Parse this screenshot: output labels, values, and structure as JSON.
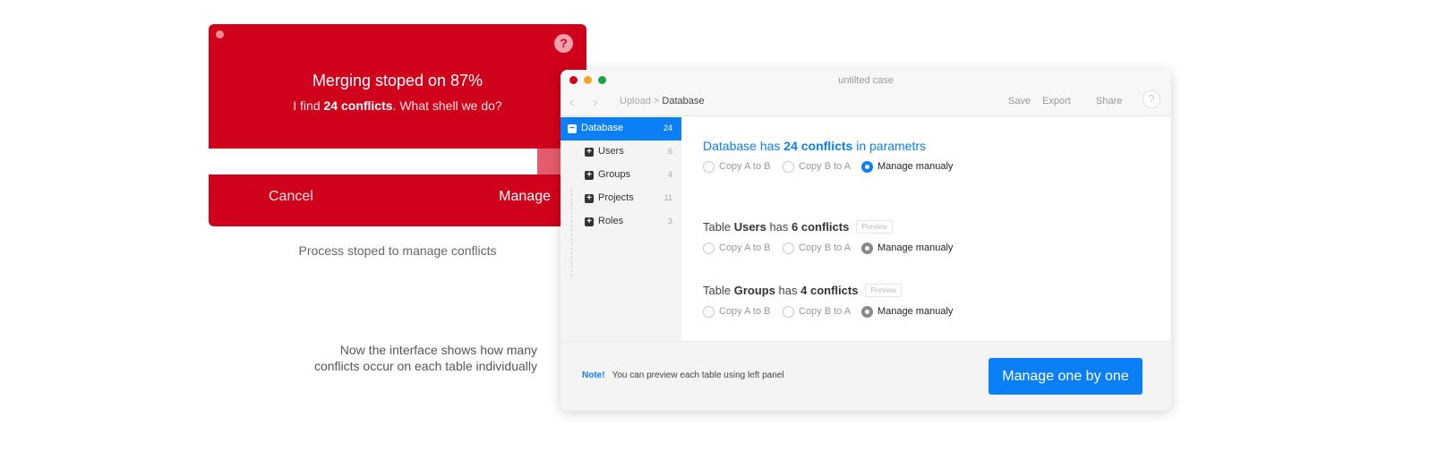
{
  "dialog": {
    "title": "Merging stoped on 87%",
    "subtitle_prefix": "I find ",
    "subtitle_bold": "24 conflicts",
    "subtitle_suffix": ". What shell we do?",
    "progress": 0.87,
    "cancel_label": "Cancel",
    "manage_label": "Manage",
    "help_symbol": "?"
  },
  "captions": {
    "dialog_caption": "Process stoped to manage conflicts",
    "window_caption": "Now the interface shows how many conflicts occur on each table individually"
  },
  "window": {
    "title": "untilted case",
    "breadcrumb": {
      "parent": "Upload",
      "separator": " > ",
      "current": "Database"
    },
    "toolbar": {
      "save": "Save",
      "export": "Export",
      "share": "Share",
      "help": "?"
    },
    "sidebar": [
      {
        "label": "Database",
        "count": "24",
        "symbol": "−",
        "active": true
      },
      {
        "label": "Users",
        "count": "6",
        "symbol": "+"
      },
      {
        "label": "Groups",
        "count": "4",
        "symbol": "+"
      },
      {
        "label": "Projects",
        "count": "11",
        "symbol": "+"
      },
      {
        "label": "Roles",
        "count": "3",
        "symbol": "+"
      }
    ],
    "sections": [
      {
        "pre": "Database has ",
        "bold1": "24 conflicts",
        "post": " in parametrs",
        "options": [
          "Copy A to B",
          "Copy B to A",
          "Manage manualy"
        ]
      },
      {
        "pre": "Table ",
        "bold1": "Users",
        "mid": " has ",
        "bold2": "6 conflicts",
        "preview": "Preview",
        "options": [
          "Copy A to B",
          "Copy B to A",
          "Manage manualy"
        ]
      },
      {
        "pre": "Table ",
        "bold1": "Groups",
        "mid": " has ",
        "bold2": "4 conflicts",
        "preview": "Preview",
        "options": [
          "Copy A to B",
          "Copy B to A",
          "Manage manualy"
        ]
      }
    ],
    "footer": {
      "note_label": "Note!",
      "note_text": "You can preview each table using left panel",
      "button": "Manage one by one"
    }
  },
  "colors": {
    "dialog_red": "#d0021b",
    "accent_blue": "#0b7ff5"
  }
}
